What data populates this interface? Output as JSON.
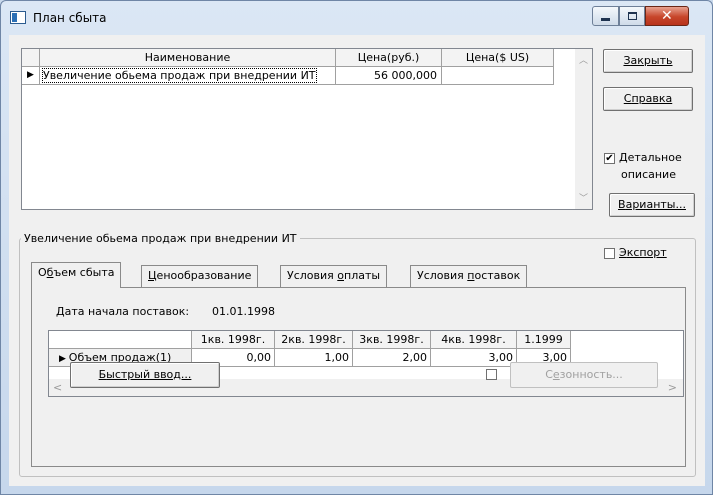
{
  "window": {
    "title": "План сбыта"
  },
  "buttons": {
    "close": {
      "u": "З",
      "rest": "акрыть"
    },
    "help": {
      "u": "С",
      "rest": "правка"
    },
    "variants": {
      "u": "В",
      "rest": "арианты..."
    },
    "quick_input": {
      "u": "Б",
      "rest": "ыстрый ввод..."
    },
    "seasonality": {
      "pre": "С",
      "u": "е",
      "rest": "зонность..."
    }
  },
  "top_grid": {
    "headers": [
      "Наименование",
      "Цена(руб.)",
      "Цена($ US)"
    ],
    "row": {
      "name": "Увеличение обьема продаж при внедрении ИТ",
      "price_rub": "56 000,000",
      "price_usd": ""
    }
  },
  "detailed": {
    "checked": "✔",
    "u": "Д",
    "line1_rest": "етальное",
    "line2": "описание"
  },
  "export": {
    "checked": "",
    "u": "Э",
    "rest": "кспорт"
  },
  "group": {
    "title": "Увеличение обьема продаж при внедрении ИТ"
  },
  "tabs": [
    {
      "pre": "О",
      "u": "б",
      "rest": "ъем сбыта"
    },
    {
      "pre": "",
      "u": "Ц",
      "rest": "енообразование"
    },
    {
      "pre": "Условия ",
      "u": "о",
      "rest": "платы"
    },
    {
      "pre": "Условия ",
      "u": "п",
      "rest": "оставок"
    }
  ],
  "delivery_start": {
    "label": "Дата начала поставок:",
    "value": "01.01.1998"
  },
  "volume_grid": {
    "headers": [
      "1кв. 1998г.",
      "2кв. 1998г.",
      "3кв. 1998г.",
      "4кв. 1998г.",
      "1.1999"
    ],
    "row_label": "Объем продаж(1)",
    "values": [
      "0,00",
      "1,00",
      "2,00",
      "3,00",
      "3,00"
    ]
  },
  "seasonality_checked": ""
}
